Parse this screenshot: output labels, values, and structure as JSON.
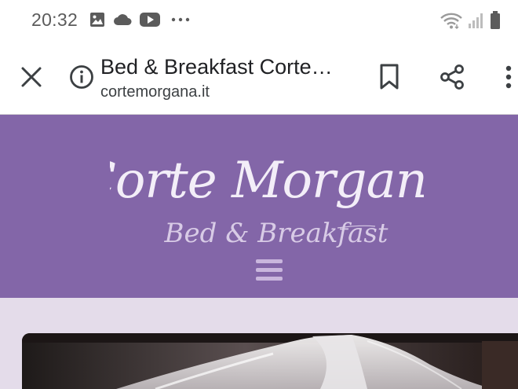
{
  "status_bar": {
    "time": "20:32",
    "left_icons": [
      "image-icon",
      "cloud-icon",
      "youtube-icon",
      "more-dots-icon"
    ],
    "right_icons": [
      "wifi-icon",
      "signal-icon",
      "battery-icon"
    ]
  },
  "toolbar": {
    "title": "Bed & Breakfast Corte…",
    "url": "cortemorgana.it",
    "icons": [
      "close-icon",
      "info-icon",
      "bookmark-icon",
      "share-icon",
      "more-vert-icon"
    ]
  },
  "site": {
    "logo_line1": "Corte Morgana",
    "logo_line2": "Bed & Breakfast",
    "menu_icon": "hamburger-icon"
  },
  "colors": {
    "header_bg": "#8366a8",
    "content_bg": "#e4dcea",
    "hamburger": "#c9b6dd"
  }
}
